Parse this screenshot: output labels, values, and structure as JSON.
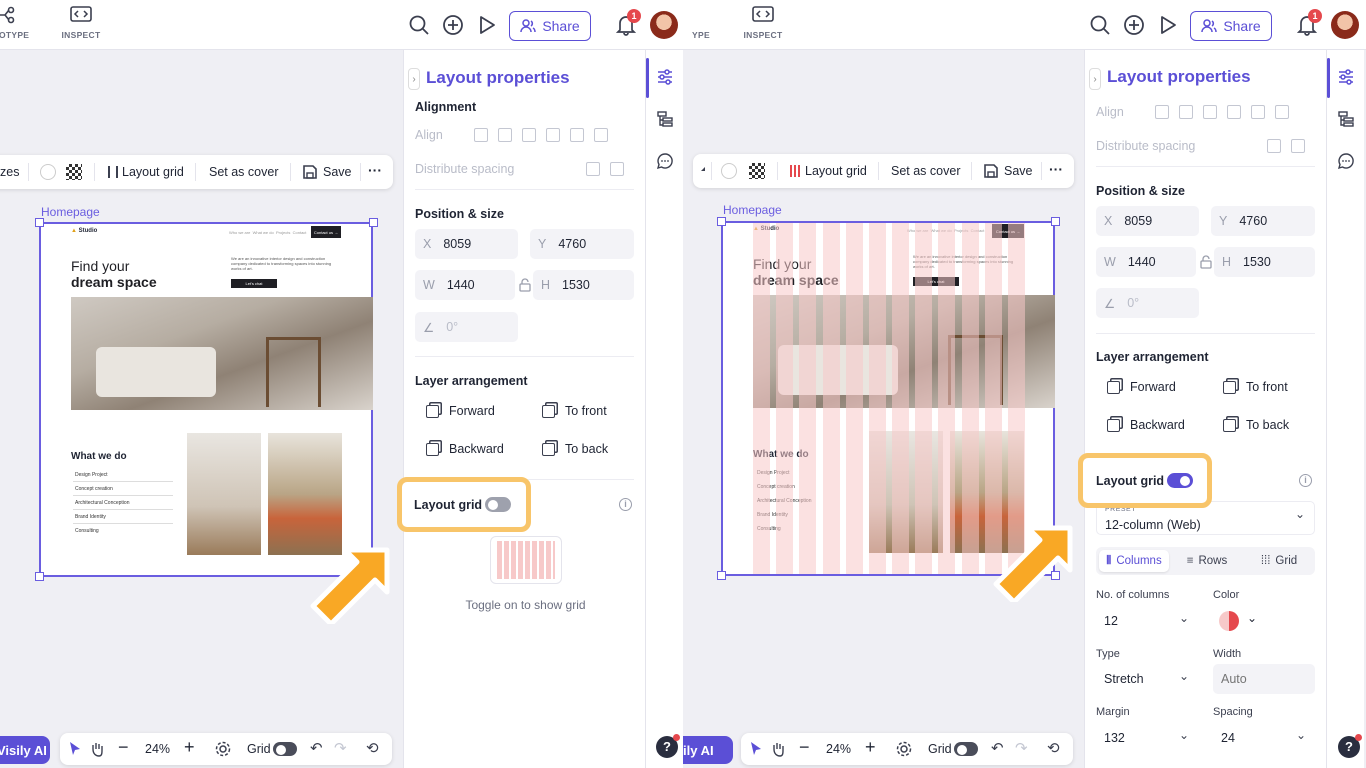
{
  "topbar": {
    "tab_prototype": "PROTOTYPE",
    "tab_prototype_clip": "OTOTYPE",
    "tab_prototype_clip_r": "YPE",
    "tab_inspect": "INSPECT",
    "share_label": "Share",
    "notification_count": "1"
  },
  "panel": {
    "title": "Layout properties",
    "alignment_heading": "Alignment",
    "align_label": "Align",
    "distribute_label": "Distribute spacing",
    "position_heading": "Position & size",
    "x_key": "X",
    "x_value": "8059",
    "y_key": "Y",
    "y_value": "4760",
    "w_key": "W",
    "w_value": "1440",
    "h_key": "H",
    "h_value": "1530",
    "rotation_value": "0°",
    "layer_heading": "Layer arrangement",
    "forward": "Forward",
    "to_front": "To front",
    "backward": "Backward",
    "to_back": "To back",
    "layout_grid_label": "Layout grid",
    "toggle_hint": "Toggle on to show grid"
  },
  "grid_settings": {
    "preset_label": "PRESET",
    "preset_value": "12-column (Web)",
    "tab_columns": "Columns",
    "tab_rows": "Rows",
    "tab_grid": "Grid",
    "columns_label": "No. of columns",
    "columns_value": "12",
    "color_label": "Color",
    "type_label": "Type",
    "type_value": "Stretch",
    "width_label": "Width",
    "width_placeholder": "Auto",
    "margin_label": "Margin",
    "margin_value": "132",
    "spacing_label": "Spacing",
    "spacing_value": "24",
    "color_swatch": "#e5484d"
  },
  "toolbar": {
    "sizes_clip": "zes",
    "layout_grid": "Layout grid",
    "set_cover": "Set as cover",
    "save": "Save",
    "more": "···"
  },
  "canvas": {
    "frame_label": "Homepage",
    "brand": "Studio",
    "nav": [
      "Who we are",
      "What we do",
      "Projects",
      "Contact"
    ],
    "cta": "Contact us →",
    "hero_line1": "Find your",
    "hero_line2": "dream space",
    "hero_blurb": "We are an innovative interior design and construction company dedicated to transforming spaces into stunning works of art.",
    "hero_btn": "Let's chat",
    "section_title": "What we do",
    "services": [
      "Design Project",
      "Concept creation",
      "Architectural Conception",
      "Brand Identity",
      "Consulting"
    ]
  },
  "bottom": {
    "visily": "Visily AI",
    "visily_clip_r": "ily AI",
    "zoom": "24%",
    "grid": "Grid",
    "help": "?"
  },
  "colors": {
    "accent": "#5b4fd6",
    "highlight": "#f8c56a",
    "arrow": "#f9a825",
    "grid_overlay": "#f7c9c9"
  }
}
